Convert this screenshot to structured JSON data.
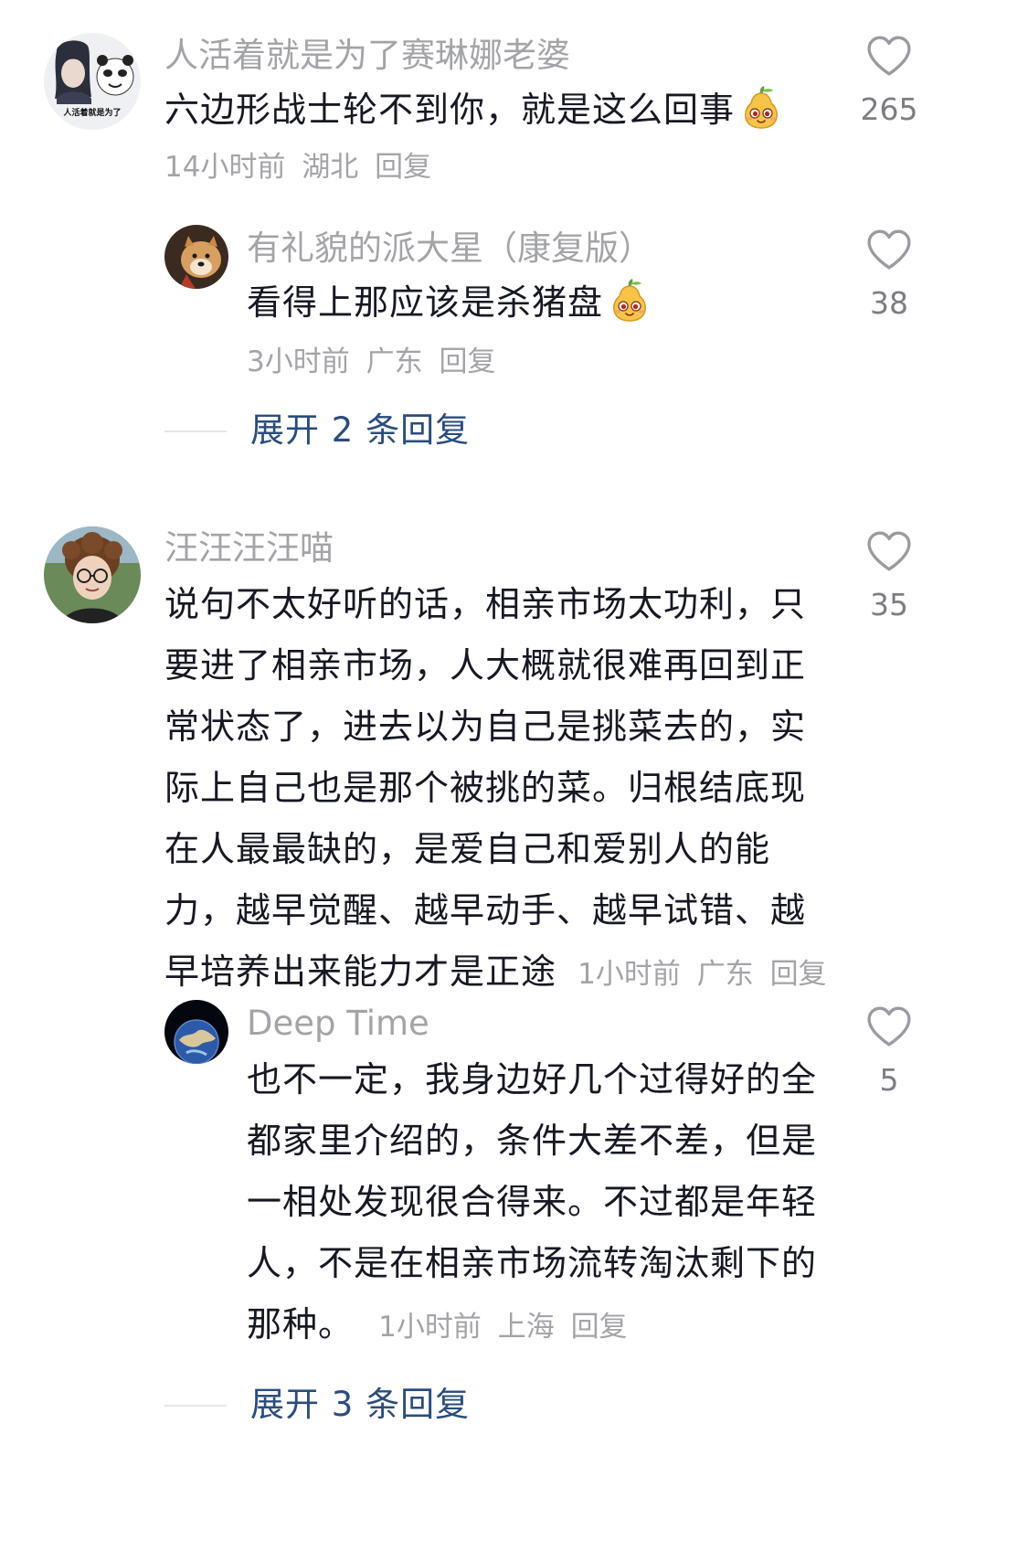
{
  "comments": [
    {
      "username": "人活着就是为了赛琳娜老婆",
      "avatar_caption": "人活着就是为了",
      "text": "六边形战士轮不到你，就是这么回事",
      "emoji": "pear-face-emoji",
      "time": "14小时前",
      "location": "湖北",
      "reply_label": "回复",
      "likes": "265",
      "replies": [
        {
          "username": "有礼貌的派大星（康复版）",
          "text": "看得上那应该是杀猪盘",
          "emoji": "pear-face-emoji",
          "time": "3小时前",
          "location": "广东",
          "reply_label": "回复",
          "likes": "38"
        }
      ],
      "expand_label": "展开 2 条回复"
    },
    {
      "username": "汪汪汪汪喵",
      "text_lines": [
        "说句不太好听的话，相亲市场太功利，只",
        "要进了相亲市场，人大概就很难再回到正",
        "常状态了，进去以为自己是挑菜去的，实",
        "际上自己也是那个被挑的菜。归根结底现",
        "在人最最缺的，是爱自己和爱别人的能",
        "力，越早觉醒、越早动手、越早试错、越",
        "早培养出来能力才是正途"
      ],
      "time": "1小时前",
      "location": "广东",
      "reply_label": "回复",
      "likes": "35",
      "replies": [
        {
          "username": "Deep Time",
          "text_lines": [
            "也不一定，我身边好几个过得好的全",
            "都家里介绍的，条件大差不差，但是",
            "一相处发现很合得来。不过都是年轻",
            "人，不是在相亲市场流转淘汰剩下的",
            "那种。"
          ],
          "time": "1小时前",
          "location": "上海",
          "reply_label": "回复",
          "likes": "5"
        }
      ],
      "expand_label": "展开 3 条回复"
    }
  ],
  "icons": {
    "like": "heart-outline-icon"
  },
  "colors": {
    "username": "#a3a4a8",
    "body_text": "#161823",
    "meta": "#a3a4a8",
    "like_count": "#7c7e84",
    "expand_link": "#2b4c7e",
    "divider": "#e6e6e8"
  }
}
